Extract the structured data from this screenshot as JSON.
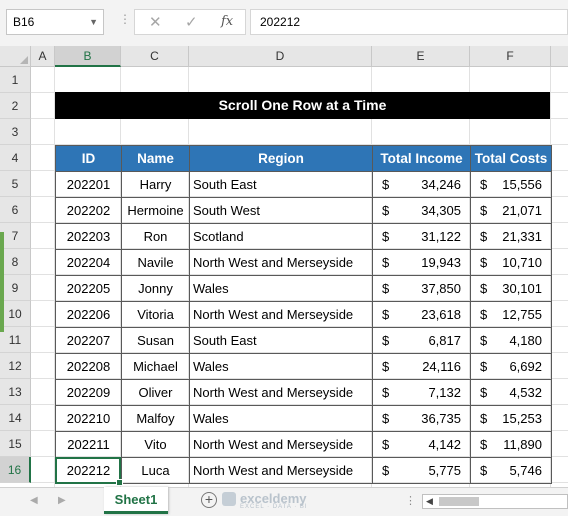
{
  "formula_bar": {
    "name_box": "B16",
    "cancel_icon": "✕",
    "enter_icon": "✓",
    "fx_label": "fx",
    "formula": "202212"
  },
  "columns": [
    "A",
    "B",
    "C",
    "D",
    "E",
    "F"
  ],
  "rows": [
    "1",
    "2",
    "3",
    "4",
    "5",
    "6",
    "7",
    "8",
    "9",
    "10",
    "11",
    "12",
    "13",
    "14",
    "15",
    "16"
  ],
  "title": "Scroll One Row at a Time",
  "table": {
    "headers": [
      "ID",
      "Name",
      "Region",
      "Total Income",
      "Total Costs"
    ],
    "currency": "$",
    "rows": [
      {
        "id": "202201",
        "name": "Harry",
        "region": "South East",
        "income": "34,246",
        "costs": "15,556"
      },
      {
        "id": "202202",
        "name": "Hermoine",
        "region": "South West",
        "income": "34,305",
        "costs": "21,071"
      },
      {
        "id": "202203",
        "name": "Ron",
        "region": "Scotland",
        "income": "31,122",
        "costs": "21,331"
      },
      {
        "id": "202204",
        "name": "Navile",
        "region": "North West and Merseyside",
        "income": "19,943",
        "costs": "10,710"
      },
      {
        "id": "202205",
        "name": "Jonny",
        "region": "Wales",
        "income": "37,850",
        "costs": "30,101"
      },
      {
        "id": "202206",
        "name": "Vitoria",
        "region": "North West and Merseyside",
        "income": "23,618",
        "costs": "12,755"
      },
      {
        "id": "202207",
        "name": "Susan",
        "region": "South East",
        "income": "6,817",
        "costs": "4,180"
      },
      {
        "id": "202208",
        "name": "Michael",
        "region": "Wales",
        "income": "24,116",
        "costs": "6,692"
      },
      {
        "id": "202209",
        "name": "Oliver",
        "region": "North West and Merseyside",
        "income": "7,132",
        "costs": "4,532"
      },
      {
        "id": "202210",
        "name": "Malfoy",
        "region": "Wales",
        "income": "36,735",
        "costs": "15,253"
      },
      {
        "id": "202211",
        "name": "Vito",
        "region": "North West and Merseyside",
        "income": "4,142",
        "costs": "11,890"
      },
      {
        "id": "202212",
        "name": "Luca",
        "region": "North West and Merseyside",
        "income": "5,775",
        "costs": "5,746"
      }
    ]
  },
  "sheet_tabs": [
    "Sheet1"
  ],
  "watermark": {
    "name": "exceldemy",
    "tagline": "EXCEL · DATA · BI"
  },
  "selected": {
    "column": "B",
    "row": "16"
  },
  "colors": {
    "header_fill": "#2e75b6",
    "selection": "#217346",
    "title_fill": "#000000"
  }
}
